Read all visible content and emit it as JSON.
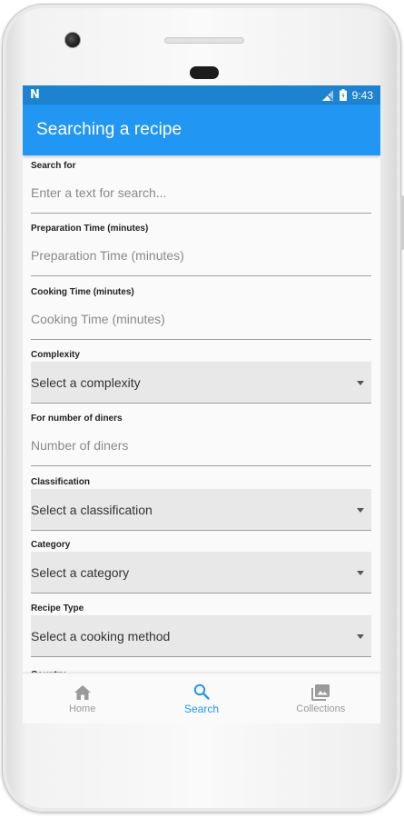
{
  "statusbar": {
    "left_icon": "n-notification-icon",
    "time": "9:43",
    "accent": "#1d82cf"
  },
  "appbar": {
    "title": "Searching a recipe",
    "color": "#2196f3"
  },
  "form": {
    "search": {
      "label": "Search for",
      "placeholder": "Enter a text for search..."
    },
    "prep_time": {
      "label": "Preparation Time (minutes)",
      "placeholder": "Preparation Time (minutes)"
    },
    "cook_time": {
      "label": "Cooking Time (minutes)",
      "placeholder": "Cooking Time (minutes)"
    },
    "complexity": {
      "label": "Complexity",
      "value": "Select a complexity"
    },
    "diners": {
      "label": "For number of diners",
      "placeholder": "Number of diners"
    },
    "classification": {
      "label": "Classification",
      "value": "Select a classification"
    },
    "category": {
      "label": "Category",
      "value": "Select a category"
    },
    "recipe_type": {
      "label": "Recipe Type",
      "value": "Select a cooking method"
    },
    "next_label": "Country"
  },
  "bottom_nav": {
    "items": [
      {
        "label": "Home",
        "icon": "home-icon",
        "active": false
      },
      {
        "label": "Search",
        "icon": "search-icon",
        "active": true
      },
      {
        "label": "Collections",
        "icon": "collections-icon",
        "active": false
      }
    ]
  }
}
